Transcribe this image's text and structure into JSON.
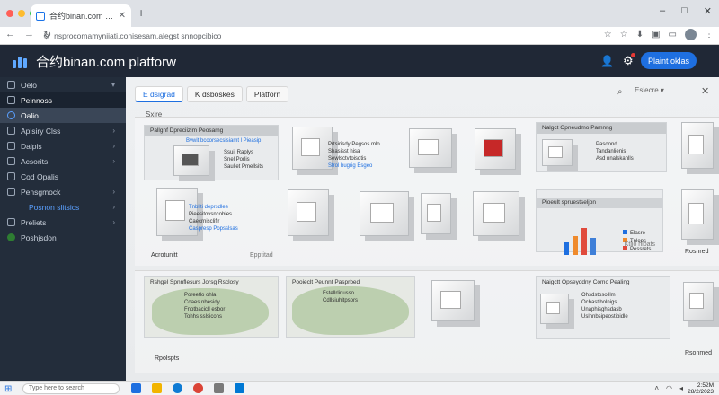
{
  "browser": {
    "tab_title": "合约binan.com Ihoms Elips",
    "url": "nsprocomamyniiati.conisesam.alegst snnopcibico",
    "window_controls": [
      "–",
      "□",
      "✕"
    ]
  },
  "header": {
    "brand": "合约binan.com platforw",
    "primary_button": "Plaint oklas"
  },
  "sidebar": {
    "items": [
      {
        "label": "Oelo"
      },
      {
        "label": "Pelnnoss"
      },
      {
        "label": "Oalio"
      },
      {
        "label": "Aplsiry Clss"
      },
      {
        "label": "Dalpis"
      },
      {
        "label": "Acsorits"
      },
      {
        "label": "Cod Opalis"
      },
      {
        "label": "Pensgmock"
      },
      {
        "label": "Posnon slitsics"
      },
      {
        "label": "Preliets"
      },
      {
        "label": "Poshjsdon"
      }
    ]
  },
  "main": {
    "tabs": [
      {
        "label": "E dsigrad"
      },
      {
        "label": "K dsboskes"
      },
      {
        "label": "Platforn"
      }
    ],
    "filter_label": "Eslecre",
    "section_label": "Sxire",
    "cards": [
      {
        "header": "Pallgnf Dpreciizim Peosamg",
        "lines": [
          "Bvwit bcoorsecsisiamt l Pieasip",
          "Ssuil Raplys",
          "Snel Porlis",
          "Saullet Pmellsits"
        ]
      },
      {
        "lines": [
          "Prtsirisdy Pegsos mlo",
          "Shasisst hisa",
          "Sewlsctvtoisdtis",
          "Strol bugrig Esgeo"
        ]
      },
      {
        "header": "Nalgct Opneudmo Pamnng",
        "lines": [
          "Pasoond",
          "Tandanlienis",
          "Asd nnalskanlls"
        ]
      },
      {
        "lines": [
          "Tnbliti deprsdlee",
          "Pieesitovsncobies",
          "Caecrnisclifir",
          "Caspresp Popsslsas"
        ]
      },
      {
        "header": "Pioeult spruestseljon"
      },
      {
        "footer_left": "Acrotunitt",
        "footer_right": "Epptitad"
      },
      {
        "footer_right": "Ktlio hioats"
      },
      {
        "footer_right": "Rosnred"
      },
      {
        "header": "Rshgel Spnnflesurs Jorsg Rsclosy",
        "lines": [
          "Poreetlo ohla",
          "Coaes nbesidy",
          "Fnotbacicll esbor",
          "Tohhs sslsicons"
        ]
      },
      {
        "header": "Pooieclt Peunnt Pasprbed",
        "lines": [
          "Fstellrlinusso",
          "Cdllsiuhitpsors"
        ]
      },
      {
        "header": "Naigctt Opseyddny Como Pealing",
        "lines": [
          "Ohsdstosoillm",
          "Ochastibolnigs",
          "Unaphisghsdasb",
          "Uslnnbsipeostibidle"
        ]
      },
      {
        "footer_left": "Rpolspts",
        "footer_right": "Rsonmed"
      }
    ]
  },
  "chart_data": {
    "type": "bar",
    "categories": [
      "1",
      "2",
      "3",
      "4"
    ],
    "values": [
      40,
      60,
      85,
      55
    ],
    "colors": [
      "#1e6fe0",
      "#ef8a2c",
      "#e04a3c",
      "#3f7fd8"
    ],
    "legend": [
      "Elasre",
      "Tnleps",
      "Pessrets"
    ]
  },
  "taskbar": {
    "search": "Type here to search",
    "time": "2:52M",
    "date": "28/2/2023"
  },
  "colors": {
    "header_bg": "#202836",
    "sidebar_bg": "#232d3b",
    "accent": "#1e6fe0"
  }
}
